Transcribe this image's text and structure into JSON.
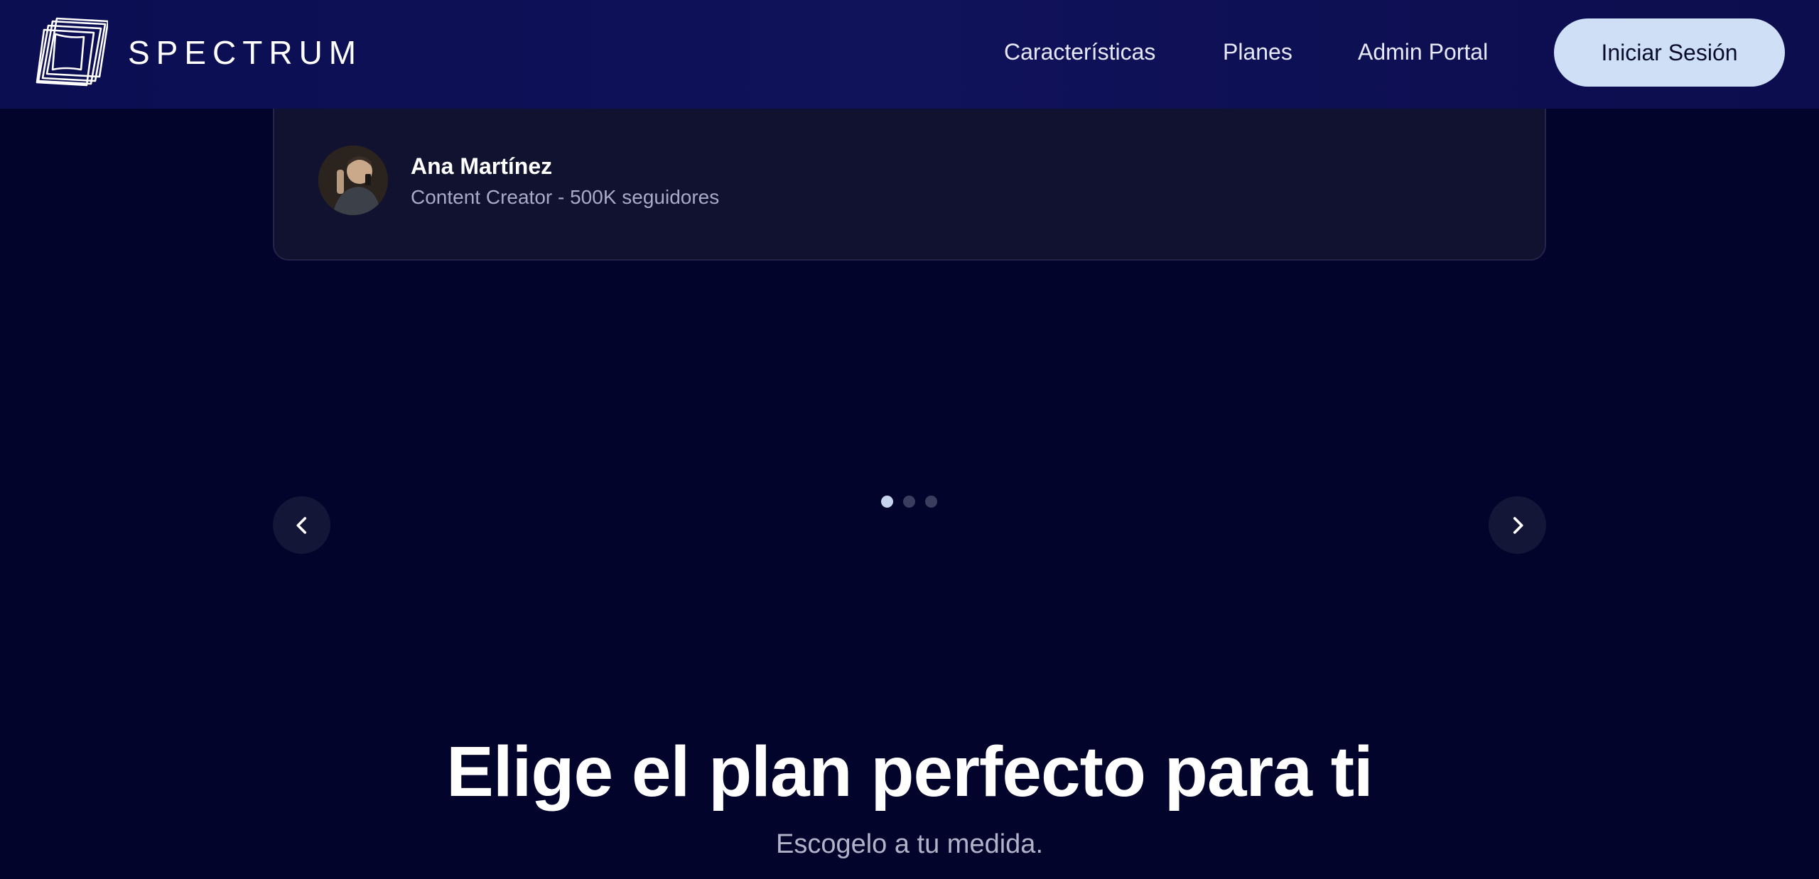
{
  "header": {
    "logo_text": "SPECTRUM",
    "logo_icon": "layered-square-logo-icon",
    "nav": {
      "features": "Características",
      "plans": "Planes",
      "admin": "Admin Portal"
    },
    "login_label": "Iniciar Sesión"
  },
  "testimonial": {
    "author_name": "Ana Martínez",
    "author_role": "Content Creator - 500K seguidores"
  },
  "carousel": {
    "prev_icon": "chevron-left-icon",
    "next_icon": "chevron-right-icon",
    "slide_count": 3,
    "active_index": 0
  },
  "pricing": {
    "headline": "Elige el plan perfecto para ti",
    "subheadline": "Escogelo a tu medida."
  },
  "colors": {
    "background": "#03042b",
    "header": "#0e1056",
    "button": "#cfe0f6",
    "card": "#11122f"
  }
}
